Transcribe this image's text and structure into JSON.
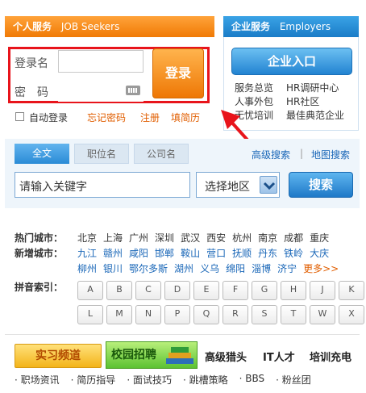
{
  "left_panel": {
    "title_cn": "个人服务",
    "title_en": "JOB Seekers"
  },
  "login": {
    "username_label": "登录名",
    "password_label": "密　码",
    "button": "登录",
    "auto_login": "自动登录",
    "forgot": "忘记密码",
    "register": "注册",
    "resume": "填简历"
  },
  "right_panel": {
    "title_cn": "企业服务",
    "title_en": "Employers",
    "button": "企业入口",
    "links": [
      [
        "服务总览",
        "HR调研中心"
      ],
      [
        "人事外包",
        "HR社区"
      ],
      [
        "无忧培训",
        "最佳典范企业"
      ]
    ]
  },
  "search": {
    "tabs": [
      "全文",
      "职位名",
      "公司名"
    ],
    "advanced": "高级搜索",
    "map": "地图搜索",
    "keyword_placeholder": "请输入关键字",
    "region": "选择地区",
    "button": "搜索"
  },
  "cities": {
    "hot_label": "热门城市：",
    "hot": [
      "北京",
      "上海",
      "广州",
      "深圳",
      "武汉",
      "西安",
      "杭州",
      "南京",
      "成都",
      "重庆"
    ],
    "new_label": "新增城市：",
    "new_row1": [
      "九江",
      "赣州",
      "咸阳",
      "邯郸",
      "鞍山",
      "营口",
      "抚顺",
      "丹东",
      "铁岭",
      "大庆"
    ],
    "new_row2": [
      "柳州",
      "银川",
      "鄂尔多斯",
      "湖州",
      "义乌",
      "绵阳",
      "淄博",
      "济宁"
    ],
    "more": "更多>>",
    "pinyin_label": "拼音索引：",
    "letters_row1": [
      "A",
      "B",
      "C",
      "D",
      "E",
      "F",
      "G",
      "H",
      "J",
      "K"
    ],
    "letters_row2": [
      "L",
      "M",
      "N",
      "P",
      "Q",
      "R",
      "S",
      "T",
      "W",
      "X",
      "Y",
      "Z"
    ]
  },
  "bottom": {
    "intern": "实习频道",
    "campus": "校园招聘",
    "headhunter": "高级猎头",
    "it": "IT人才",
    "recharge": "培训充电",
    "links": [
      "职场资讯",
      "简历指导",
      "面试技巧",
      "跳槽策略",
      "BBS",
      "粉丝团"
    ]
  },
  "colors": {
    "orange": "#f07a05",
    "blue": "#1a7cc7",
    "highlight_red": "#e8141b"
  }
}
